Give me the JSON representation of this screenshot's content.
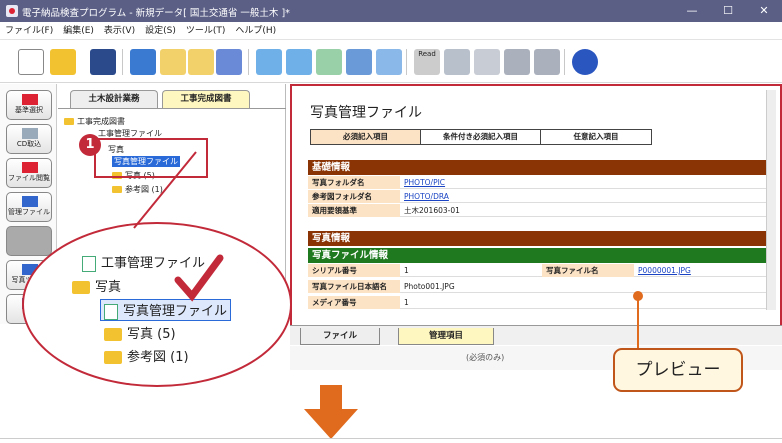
{
  "window": {
    "title": "電子納品検査プログラム - 新規データ[ 国土交通省 一般土木 ]*",
    "controls": {
      "minimize": "—",
      "maximize": "☐",
      "close": "✕"
    }
  },
  "menu": {
    "items": [
      "ファイル(F)",
      "編集(E)",
      "表示(V)",
      "設定(S)",
      "ツール(T)",
      "ヘルプ(H)"
    ]
  },
  "toolbar": {
    "read_label": "Read"
  },
  "sidebar": {
    "buttons": [
      {
        "label": "基準選択"
      },
      {
        "label": "CD取込"
      },
      {
        "label": "ファイル閲覧"
      },
      {
        "label": "管理ファイル"
      },
      {
        "label": ""
      },
      {
        "label": "写真ツール"
      },
      {
        "label": "コ"
      }
    ]
  },
  "tree": {
    "tabs": [
      "土木設計業務",
      "工事完成図書"
    ],
    "active_tab": "工事完成図書",
    "items": [
      {
        "label": "工事完成図書"
      },
      {
        "label": "工事管理ファイル"
      },
      {
        "label": "写真"
      },
      {
        "label": "写真管理ファイル"
      },
      {
        "label": "写真 (5)"
      },
      {
        "label": "参考図 (1)"
      }
    ]
  },
  "content": {
    "title": "写真管理ファイル",
    "legend": [
      "必須記入項目",
      "条件付き必須記入項目",
      "任意記入項目"
    ],
    "sections": {
      "basic": "基礎情報",
      "photo": "写真情報",
      "photo_file": "写真ファイル情報"
    },
    "basic_rows": [
      {
        "key": "写真フォルダ名",
        "value": "PHOTO/PIC"
      },
      {
        "key": "参考図フォルダ名",
        "value": "PHOTO/DRA"
      },
      {
        "key": "適用要領基準",
        "value": "土木201603-01"
      }
    ],
    "photo_rows": [
      {
        "key": "シリアル番号",
        "value": "1",
        "key2": "写真ファイル名",
        "value2": "P0000001.JPG"
      },
      {
        "key": "写真ファイル日本語名",
        "value": "Photo001.JPG"
      },
      {
        "key": "メディア番号",
        "value": "1"
      }
    ]
  },
  "bottom_tabs": [
    "ファイル",
    "管理項目"
  ],
  "zoom": {
    "items": [
      "工事管理ファイル",
      "写真",
      "写真管理ファイル",
      "写真 (5)",
      "参考図 (1)"
    ]
  },
  "annotations": {
    "step": "1",
    "callout": "プレビュー",
    "dropdown_hint": "(必須のみ)"
  },
  "colors": {
    "titlebar": "#5b5f86",
    "accent_red": "#c22a3a",
    "basic_section": "#8a3406",
    "photo_section": "#1f7a1f",
    "key_cell": "#fde3c6",
    "active_tab": "#fff7c0",
    "arrow": "#e06a1d"
  }
}
